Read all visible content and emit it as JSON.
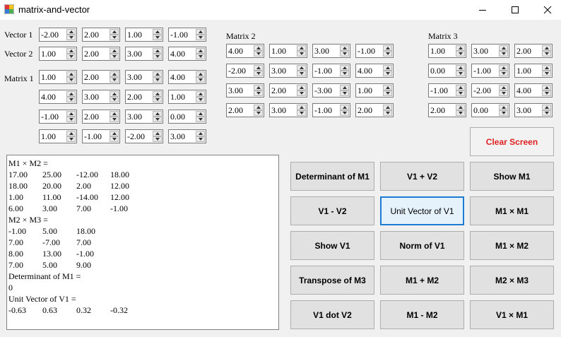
{
  "window": {
    "title": "matrix-and-vector"
  },
  "labels": {
    "vector1": "Vector 1",
    "vector2": "Vector 2",
    "matrix1": "Matrix 1",
    "matrix2": "Matrix 2",
    "matrix3": "Matrix 3"
  },
  "vector1": [
    "-2.00",
    "2.00",
    "1.00",
    "-1.00"
  ],
  "vector2": [
    "1.00",
    "2.00",
    "3.00",
    "4.00"
  ],
  "matrix1": [
    [
      "1.00",
      "2.00",
      "3.00",
      "4.00"
    ],
    [
      "4.00",
      "3.00",
      "2.00",
      "1.00"
    ],
    [
      "-1.00",
      "2.00",
      "3.00",
      "0.00"
    ],
    [
      "1.00",
      "-1.00",
      "-2.00",
      "3.00"
    ]
  ],
  "matrix2": [
    [
      "4.00",
      "1.00",
      "3.00",
      "-1.00"
    ],
    [
      "-2.00",
      "3.00",
      "-1.00",
      "4.00"
    ],
    [
      "3.00",
      "2.00",
      "-3.00",
      "1.00"
    ],
    [
      "2.00",
      "3.00",
      "-1.00",
      "2.00"
    ]
  ],
  "matrix3": [
    [
      "1.00",
      "3.00",
      "2.00"
    ],
    [
      "0.00",
      "-1.00",
      "1.00"
    ],
    [
      "-1.00",
      "-2.00",
      "4.00"
    ],
    [
      "2.00",
      "0.00",
      "3.00"
    ]
  ],
  "output": [
    [
      "M1 × M2 ="
    ],
    [
      "17.00",
      "25.00",
      "-12.00",
      "18.00"
    ],
    [
      "18.00",
      "20.00",
      "2.00",
      "12.00"
    ],
    [
      "1.00",
      "11.00",
      "-14.00",
      "12.00"
    ],
    [
      "6.00",
      "3.00",
      "7.00",
      "-1.00"
    ],
    [
      "M2 × M3 ="
    ],
    [
      "-1.00",
      "5.00",
      "18.00"
    ],
    [
      "7.00",
      "-7.00",
      "7.00"
    ],
    [
      "8.00",
      "13.00",
      "-1.00"
    ],
    [
      "7.00",
      "5.00",
      "9.00"
    ],
    [
      "Determinant of M1 ="
    ],
    [
      "0"
    ],
    [
      "Unit Vector of V1 ="
    ],
    [
      "-0.63",
      "0.63",
      "0.32",
      "-0.32"
    ]
  ],
  "buttons": {
    "clear": "Clear Screen",
    "det_m1": "Determinant of M1",
    "v1_plus_v2": "V1 + V2",
    "show_m1": "Show M1",
    "v1_minus_v2": "V1 - V2",
    "unit_v1": "Unit Vector of  V1",
    "m1_x_m1": "M1 ×  M1",
    "show_v1": "Show V1",
    "norm_v1": "Norm of  V1",
    "m1_x_m2": "M1 ×  M2",
    "transpose_m3": "Transpose of M3",
    "m1_plus_m2": "M1 + M2",
    "m2_x_m3": "M2 ×  M3",
    "v1_dot_v2": "V1 dot V2",
    "m1_minus_m2": "M1 - M2",
    "v1_x_m1": "V1 × M1"
  },
  "colors": {
    "accent": "#1e7bd3",
    "clear_text": "#e02020"
  }
}
